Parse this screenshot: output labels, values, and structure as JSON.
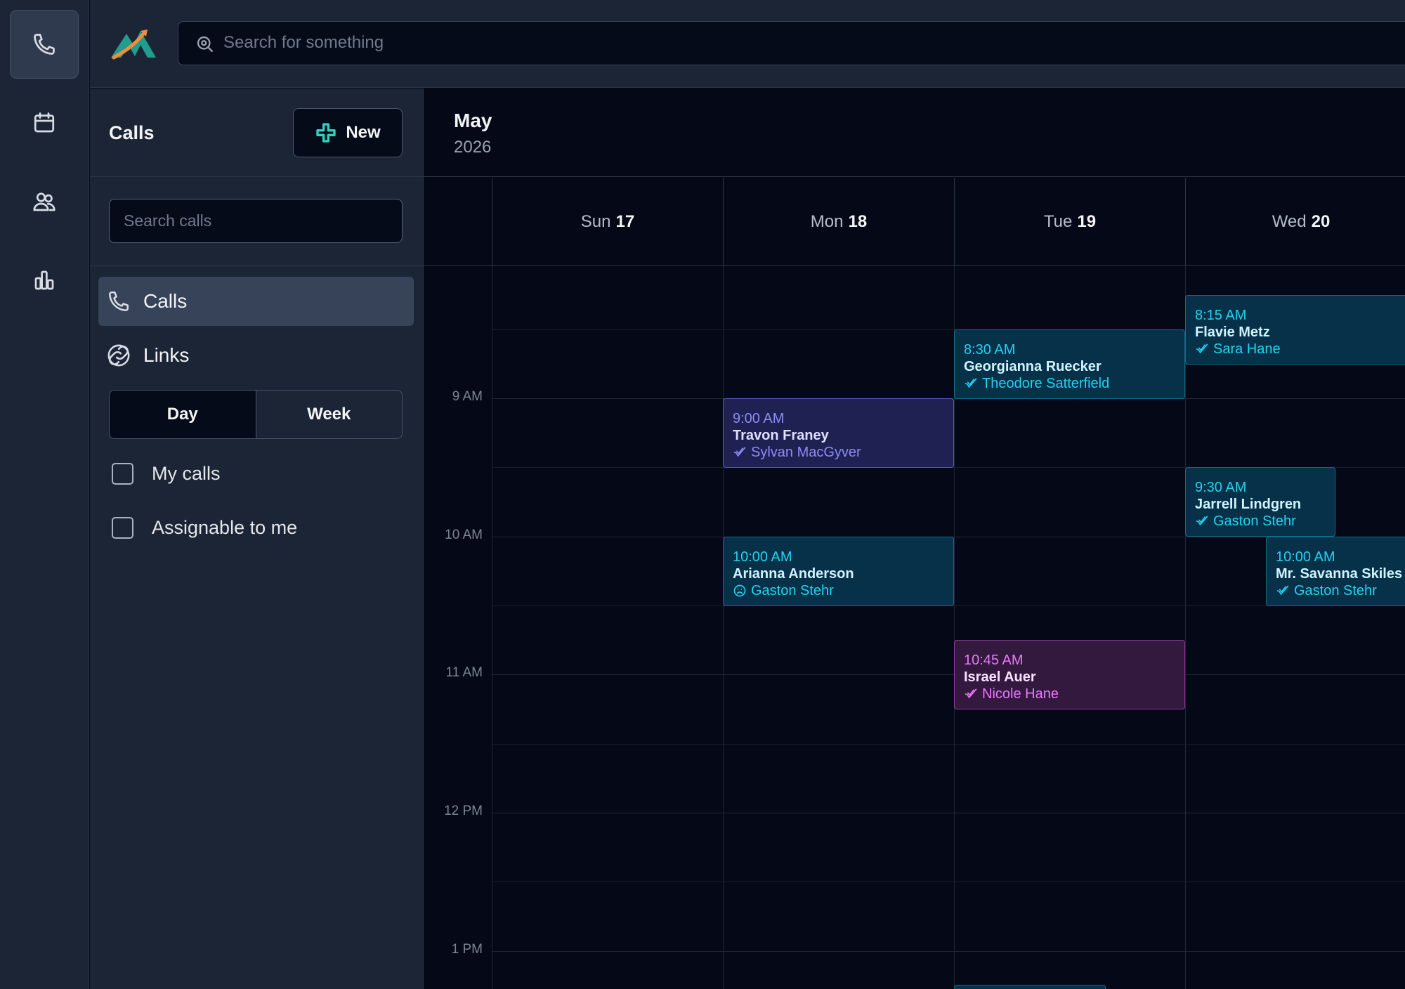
{
  "topbar": {
    "search_placeholder": "Search for something"
  },
  "rail": {
    "items": [
      "phone-icon",
      "calendar-icon",
      "users-icon",
      "chart-icon"
    ]
  },
  "panel": {
    "title": "Calls",
    "new_label": "New",
    "search_placeholder": "Search calls",
    "nav": [
      {
        "label": "Calls",
        "icon": "phone-icon",
        "active": true
      },
      {
        "label": "Links",
        "icon": "link-icon",
        "active": false
      }
    ],
    "view_toggle": {
      "day": "Day",
      "week": "Week",
      "selected": "Day"
    },
    "filters": [
      {
        "label": "My calls",
        "checked": false
      },
      {
        "label": "Assignable to me",
        "checked": false
      }
    ]
  },
  "calendar": {
    "month": "May",
    "year": "2026",
    "days": [
      {
        "name": "Sun",
        "num": "17"
      },
      {
        "name": "Mon",
        "num": "18"
      },
      {
        "name": "Tue",
        "num": "19"
      },
      {
        "name": "Wed",
        "num": "20"
      }
    ],
    "times": [
      "9 AM",
      "10 AM",
      "11 AM",
      "12 PM",
      "1 PM"
    ],
    "events": [
      {
        "time": "8:15 AM",
        "name": "Flavie Metz",
        "assignee": "Sara Hane",
        "status": "check",
        "color": "teal"
      },
      {
        "time": "8:30 AM",
        "name": "Georgianna Ruecker",
        "assignee": "Theodore Satterfield",
        "status": "check",
        "color": "teal"
      },
      {
        "time": "9:00 AM",
        "name": "Travon Franey",
        "assignee": "Sylvan MacGyver",
        "status": "check",
        "color": "violet"
      },
      {
        "time": "9:30 AM",
        "name": "Jarrell Lindgren",
        "assignee": "Gaston Stehr",
        "status": "check",
        "color": "teal"
      },
      {
        "time": "10:00 AM",
        "name": "Arianna Anderson",
        "assignee": "Gaston Stehr",
        "status": "sad",
        "color": "teal"
      },
      {
        "time": "10:00 AM",
        "name": "Mr. Savanna Skiles",
        "assignee": "Gaston Stehr",
        "status": "check",
        "color": "teal"
      },
      {
        "time": "10:45 AM",
        "name": "Israel Auer",
        "assignee": "Nicole Hane",
        "status": "check",
        "color": "pink"
      }
    ]
  },
  "colors": {
    "teal": "#22d3ee",
    "violet": "#8b8cf7",
    "pink": "#e879f9",
    "accent": "#2dd4bf"
  }
}
